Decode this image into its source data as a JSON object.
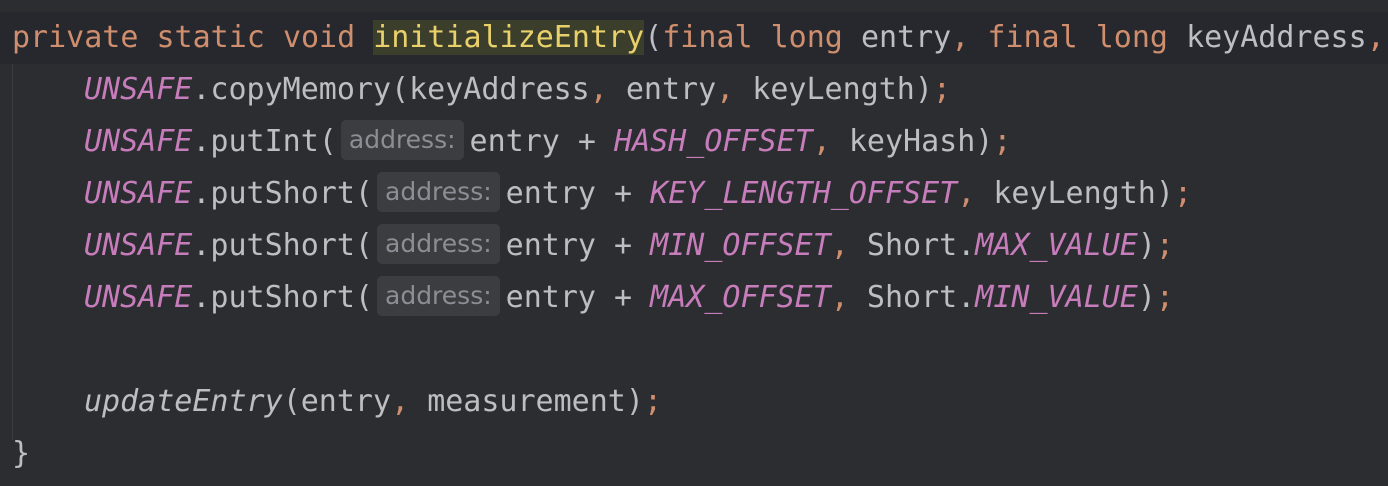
{
  "code": {
    "line1": {
      "kw_private": "private",
      "kw_static": "static",
      "kw_void": "void",
      "method": "initializeEntry",
      "open": "(",
      "kw_final1": "final",
      "kw_long1": "long",
      "p1": "entry",
      "comma1": ",",
      "kw_final2": "final",
      "kw_long2": "long",
      "p2": "keyAddress",
      "comma2": ","
    },
    "line2": {
      "unsafe": "UNSAFE",
      "call": ".copyMemory(keyAddress",
      "c1": ",",
      "a2": "entry",
      "c2": ",",
      "a3": "keyLength)",
      "semi": ";"
    },
    "line3": {
      "unsafe": "UNSAFE",
      "call": ".putInt(",
      "hint": "address:",
      "expr": "entry + ",
      "const": "HASH_OFFSET",
      "c1": ",",
      "a2": "keyHash)",
      "semi": ";"
    },
    "line4": {
      "unsafe": "UNSAFE",
      "call": ".putShort(",
      "hint": "address:",
      "expr": "entry + ",
      "const": "KEY_LENGTH_OFFSET",
      "c1": ",",
      "a2": "keyLength)",
      "semi": ";"
    },
    "line5": {
      "unsafe": "UNSAFE",
      "call": ".putShort(",
      "hint": "address:",
      "expr": "entry + ",
      "const": "MIN_OFFSET",
      "c1": ",",
      "a2": "Short.",
      "const2": "MAX_VALUE",
      "close": ")",
      "semi": ";"
    },
    "line6": {
      "unsafe": "UNSAFE",
      "call": ".putShort(",
      "hint": "address:",
      "expr": "entry + ",
      "const": "MAX_OFFSET",
      "c1": ",",
      "a2": "Short.",
      "const2": "MIN_VALUE",
      "close": ")",
      "semi": ";"
    },
    "line8": {
      "method": "updateEntry",
      "args1": "(entry",
      "c1": ",",
      "args2": "measurement)",
      "semi": ";"
    },
    "line9": {
      "brace": "}"
    }
  },
  "colors": {
    "background": "#2b2d30",
    "keyword": "#cf8e6d",
    "field": "#c77dbb",
    "highlight": "#e8d06b"
  }
}
